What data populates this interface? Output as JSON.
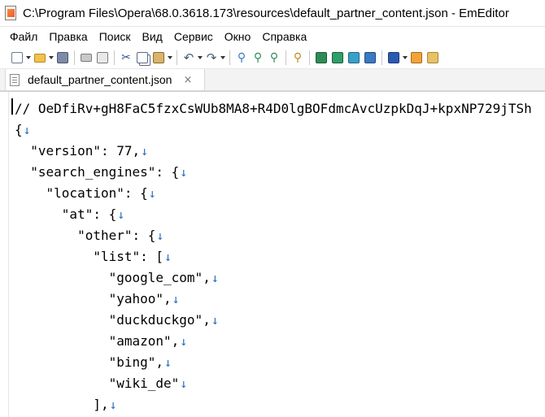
{
  "window": {
    "title": "C:\\Program Files\\Opera\\68.0.3618.173\\resources\\default_partner_content.json - EmEditor"
  },
  "menu": [
    "Файл",
    "Правка",
    "Поиск",
    "Вид",
    "Сервис",
    "Окно",
    "Справка"
  ],
  "toolbar": {
    "buttons": [
      "new-file",
      "open-file",
      "save",
      "print",
      "print-preview",
      "cut",
      "copy",
      "paste",
      "undo",
      "redo",
      "find",
      "find-next",
      "find-previous",
      "find-in-files",
      "macro-1",
      "macro-2",
      "macro-3",
      "macro-4",
      "customize",
      "settings",
      "properties"
    ]
  },
  "tab": {
    "label": "default_partner_content.json",
    "close": "×"
  },
  "editor": {
    "lines": [
      {
        "indent": "",
        "text": "// OeDfiRv+gH8FaC5fzxCsWUb8MA8+R4D0lgBOFdmcAvcUzpkDqJ+kpxNP729jTSh",
        "nl": false
      },
      {
        "indent": "",
        "text": "{",
        "nl": true
      },
      {
        "indent": "  ",
        "text": "\"version\": 77,",
        "nl": true
      },
      {
        "indent": "  ",
        "text": "\"search_engines\": {",
        "nl": true
      },
      {
        "indent": "    ",
        "text": "\"location\": {",
        "nl": true
      },
      {
        "indent": "      ",
        "text": "\"at\": {",
        "nl": true
      },
      {
        "indent": "        ",
        "text": "\"other\": {",
        "nl": true
      },
      {
        "indent": "          ",
        "text": "\"list\": [",
        "nl": true
      },
      {
        "indent": "            ",
        "text": "\"google_com\",",
        "nl": true
      },
      {
        "indent": "            ",
        "text": "\"yahoo\",",
        "nl": true
      },
      {
        "indent": "            ",
        "text": "\"duckduckgo\",",
        "nl": true
      },
      {
        "indent": "            ",
        "text": "\"amazon\",",
        "nl": true
      },
      {
        "indent": "            ",
        "text": "\"bing\",",
        "nl": true
      },
      {
        "indent": "            ",
        "text": "\"wiki_de\"",
        "nl": true
      },
      {
        "indent": "          ",
        "text": "],",
        "nl": true
      }
    ],
    "newline_mark": "↓"
  }
}
